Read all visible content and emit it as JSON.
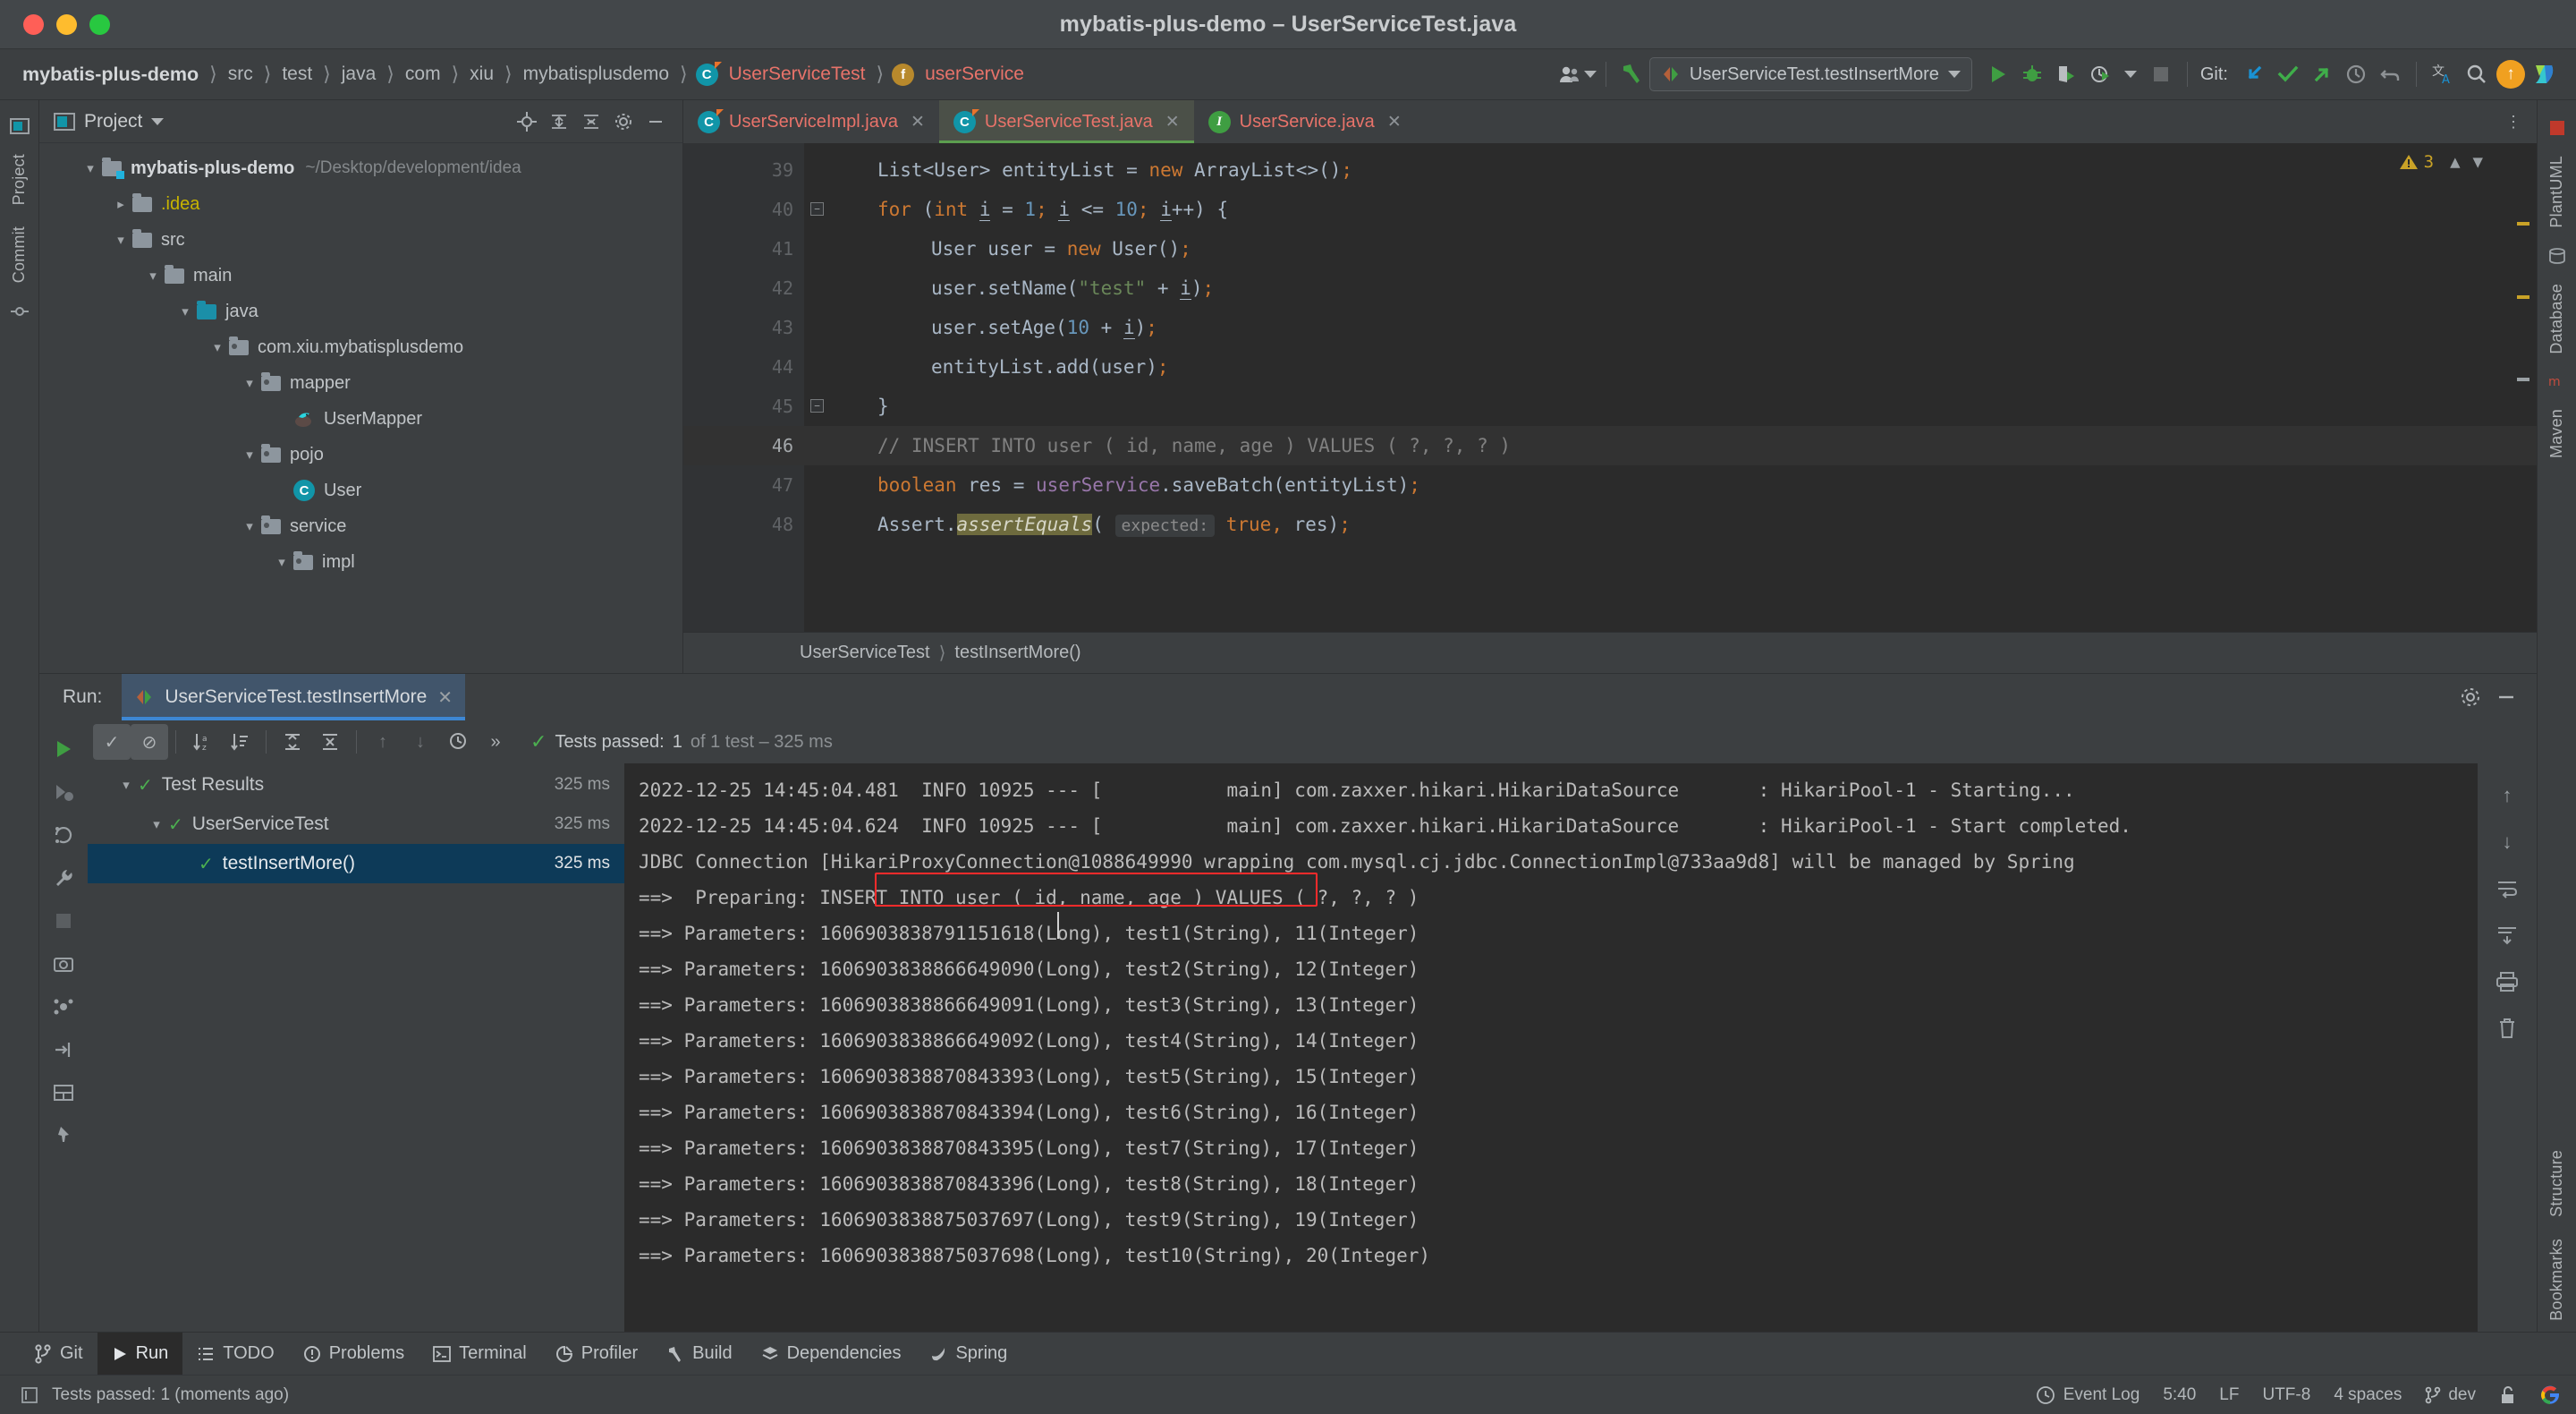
{
  "window": {
    "title": "mybatis-plus-demo – UserServiceTest.java",
    "traffic_lights": [
      "close-button",
      "minimize-button",
      "maximize-button"
    ]
  },
  "navbar": {
    "breadcrumbs": [
      {
        "label": "mybatis-plus-demo",
        "kind": "project"
      },
      {
        "label": "src",
        "kind": "dir"
      },
      {
        "label": "test",
        "kind": "dir"
      },
      {
        "label": "java",
        "kind": "dir"
      },
      {
        "label": "com",
        "kind": "dir"
      },
      {
        "label": "xiu",
        "kind": "dir"
      },
      {
        "label": "mybatisplusdemo",
        "kind": "dir"
      },
      {
        "label": "UserServiceTest",
        "kind": "class",
        "icon": "class-icon"
      },
      {
        "label": "userService",
        "kind": "field",
        "icon": "field-icon"
      }
    ],
    "run_config": "UserServiceTest.testInsertMore",
    "git_label": "Git:",
    "icons": {
      "account": "account-icon",
      "hammer": "build-hammer-icon",
      "run": "run-icon",
      "debug": "debug-icon",
      "coverage": "run-with-coverage-icon",
      "profile": "profiler-icon",
      "stop": "stop-icon",
      "update": "git-update-icon",
      "commit": "git-commit-icon",
      "push": "git-push-icon",
      "history": "git-history-icon",
      "rollback": "git-rollback-icon",
      "translate": "translate-icon",
      "search": "search-icon",
      "upload": "upload-icon",
      "ide-logo": "ide-logo-icon"
    }
  },
  "left_strip": {
    "tabs": [
      "Project",
      "Commit"
    ],
    "icons": [
      "project-icon",
      "commit-icon"
    ]
  },
  "right_strip": {
    "tabs": [
      "PlantUML",
      "Database",
      "Maven"
    ]
  },
  "project_panel": {
    "title": "Project",
    "header_icons": [
      "locate-icon",
      "expand-all-icon",
      "collapse-all-icon",
      "settings-gear-icon",
      "hide-icon",
      "more-icon"
    ],
    "tree": [
      {
        "label": "mybatis-plus-demo",
        "suffix": "~/Desktop/development/idea",
        "depth": 0,
        "arrow": "down",
        "icon": "module-folder-icon",
        "bold": true
      },
      {
        "label": ".idea",
        "depth": 1,
        "arrow": "right",
        "icon": "folder-icon",
        "color": "yellow"
      },
      {
        "label": "src",
        "depth": 1,
        "arrow": "down",
        "icon": "folder-icon"
      },
      {
        "label": "main",
        "depth": 2,
        "arrow": "down",
        "icon": "folder-icon"
      },
      {
        "label": "java",
        "depth": 3,
        "arrow": "down",
        "icon": "source-folder-icon"
      },
      {
        "label": "com.xiu.mybatisplusdemo",
        "depth": 4,
        "arrow": "down",
        "icon": "package-icon"
      },
      {
        "label": "mapper",
        "depth": 5,
        "arrow": "down",
        "icon": "package-icon"
      },
      {
        "label": "UserMapper",
        "depth": 6,
        "arrow": "none",
        "icon": "mybatis-mapper-icon"
      },
      {
        "label": "pojo",
        "depth": 5,
        "arrow": "down",
        "icon": "package-icon"
      },
      {
        "label": "User",
        "depth": 6,
        "arrow": "none",
        "icon": "class-icon"
      },
      {
        "label": "service",
        "depth": 5,
        "arrow": "down",
        "icon": "package-icon"
      },
      {
        "label": "impl",
        "depth": 6,
        "arrow": "down",
        "icon": "package-icon"
      }
    ]
  },
  "editor": {
    "tabs": [
      {
        "label": "UserServiceImpl.java",
        "icon": "class-icon",
        "active": false
      },
      {
        "label": "UserServiceTest.java",
        "icon": "test-class-icon",
        "active": true
      },
      {
        "label": "UserService.java",
        "icon": "interface-icon",
        "active": false
      }
    ],
    "warning_count": "3",
    "breadcrumb": [
      "UserServiceTest",
      "testInsertMore()"
    ],
    "lines": [
      {
        "num": "39",
        "fold": false,
        "current": false
      },
      {
        "num": "40",
        "fold": true,
        "current": false
      },
      {
        "num": "41",
        "fold": false,
        "current": false
      },
      {
        "num": "42",
        "fold": false,
        "current": false
      },
      {
        "num": "43",
        "fold": false,
        "current": false
      },
      {
        "num": "44",
        "fold": false,
        "current": false
      },
      {
        "num": "45",
        "fold": true,
        "current": false
      },
      {
        "num": "46",
        "fold": false,
        "current": true
      },
      {
        "num": "47",
        "fold": false,
        "current": false
      },
      {
        "num": "48",
        "fold": false,
        "current": false
      }
    ],
    "code_text": [
      "List<User> entityList = new ArrayList<>();",
      "for (int i = 1; i <= 10; i++) {",
      "User user = new User();",
      "user.setName(\"test\" + i);",
      "user.setAge(10 + i);",
      "entityList.add(user);",
      "}",
      "// INSERT INTO user ( id, name, age ) VALUES ( ?, ?, ? )",
      "boolean res = userService.saveBatch(entityList);",
      "Assert.assertEquals( expected: true, res);"
    ]
  },
  "run_panel": {
    "label": "Run:",
    "tab_title": "UserServiceTest.testInsertMore",
    "toolbar_icons": [
      "rerun-icon",
      "show-passed-icon",
      "show-ignored-icon",
      "sort-alphabetically-icon",
      "sort-by-duration-icon",
      "expand-all-icon",
      "collapse-all-icon",
      "prev-failed-icon",
      "next-failed-icon",
      "history-icon",
      "more-icon"
    ],
    "status": {
      "prefix": "Tests passed:",
      "count": "1",
      "suffix": "of 1 test – 325 ms"
    },
    "tests": [
      {
        "label": "Test Results",
        "time": "325 ms",
        "depth": 0,
        "arrow": "down",
        "selected": false
      },
      {
        "label": "UserServiceTest",
        "time": "325 ms",
        "depth": 1,
        "arrow": "down",
        "selected": false
      },
      {
        "label": "testInsertMore()",
        "time": "325 ms",
        "depth": 2,
        "arrow": "none",
        "selected": true
      }
    ],
    "console": [
      "2022-12-25 14:45:04.481  INFO 10925 --- [           main] com.zaxxer.hikari.HikariDataSource       : HikariPool-1 - Starting...",
      "2022-12-25 14:45:04.624  INFO 10925 --- [           main] com.zaxxer.hikari.HikariDataSource       : HikariPool-1 - Start completed.",
      "JDBC Connection [HikariProxyConnection@1088649990 wrapping com.mysql.cj.jdbc.ConnectionImpl@733aa9d8] will be managed by Spring",
      "==>  Preparing: INSERT INTO user ( id, name, age ) VALUES ( ?, ?, ? )",
      "==> Parameters: 1606903838791151618(Long), test1(String), 11(Integer)",
      "==> Parameters: 1606903838866649090(Long), test2(String), 12(Integer)",
      "==> Parameters: 1606903838866649091(Long), test3(String), 13(Integer)",
      "==> Parameters: 1606903838866649092(Long), test4(String), 14(Integer)",
      "==> Parameters: 1606903838870843393(Long), test5(String), 15(Integer)",
      "==> Parameters: 1606903838870843394(Long), test6(String), 16(Integer)",
      "==> Parameters: 1606903838870843395(Long), test7(String), 17(Integer)",
      "==> Parameters: 1606903838870843396(Long), test8(String), 18(Integer)",
      "==> Parameters: 1606903838875037697(Long), test9(String), 19(Integer)",
      "==> Parameters: 1606903838875037698(Long), test10(String), 20(Integer)"
    ],
    "console_side_icons": [
      "scroll-up-icon",
      "scroll-down-icon",
      "soft-wrap-icon",
      "scroll-to-end-icon",
      "print-icon",
      "clear-all-icon"
    ],
    "highlight_color": "#ff2b2b"
  },
  "toolwindow_bar": [
    {
      "label": "Git",
      "icon": "git-branch-icon",
      "active": false
    },
    {
      "label": "Run",
      "icon": "run-icon",
      "active": true
    },
    {
      "label": "TODO",
      "icon": "todo-icon",
      "active": false
    },
    {
      "label": "Problems",
      "icon": "problems-icon",
      "active": false
    },
    {
      "label": "Terminal",
      "icon": "terminal-icon",
      "active": false
    },
    {
      "label": "Profiler",
      "icon": "profiler-icon",
      "active": false
    },
    {
      "label": "Build",
      "icon": "build-icon",
      "active": false
    },
    {
      "label": "Dependencies",
      "icon": "dependencies-icon",
      "active": false
    },
    {
      "label": "Spring",
      "icon": "spring-icon",
      "active": false
    }
  ],
  "status_bar": {
    "message": "Tests passed: 1 (moments ago)",
    "event_log": "Event Log",
    "caret": "5:40",
    "line_sep": "LF",
    "encoding": "UTF-8",
    "indent": "4 spaces",
    "branch": "dev",
    "icons": [
      "memory-icon",
      "event-log-icon",
      "branch-icon",
      "unlock-icon",
      "google-icon"
    ]
  }
}
